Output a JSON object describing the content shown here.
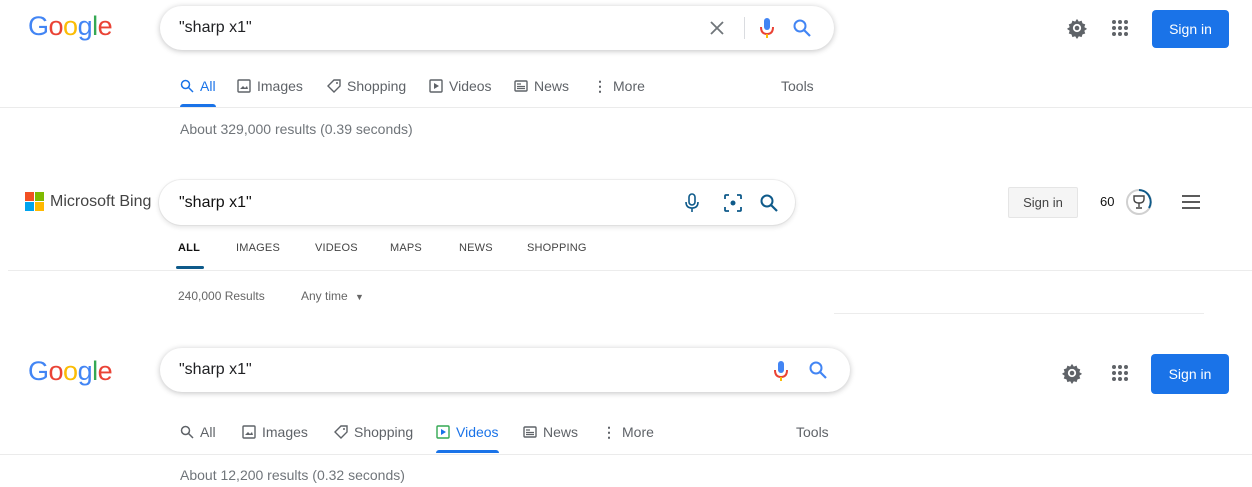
{
  "panel1": {
    "logo": "Google",
    "query": "\"sharp x1\"",
    "tabs": [
      {
        "label": "All",
        "icon": "search-icon",
        "active": true
      },
      {
        "label": "Images",
        "icon": "image-icon"
      },
      {
        "label": "Shopping",
        "icon": "tag-icon"
      },
      {
        "label": "Videos",
        "icon": "play-icon"
      },
      {
        "label": "News",
        "icon": "news-icon"
      },
      {
        "label": "More",
        "icon": "more-vert-icon"
      }
    ],
    "tools": "Tools",
    "stats": "About 329,000 results (0.39 seconds)",
    "signin": "Sign in"
  },
  "panel2": {
    "logo": "Microsoft Bing",
    "query": "\"sharp x1\"",
    "tabs": [
      "ALL",
      "IMAGES",
      "VIDEOS",
      "MAPS",
      "NEWS",
      "SHOPPING"
    ],
    "signin": "Sign in",
    "points": "60",
    "results": "240,000 Results",
    "time_filter": "Any time"
  },
  "panel3": {
    "logo": "Google",
    "query": "\"sharp x1\"",
    "tabs": [
      {
        "label": "All",
        "icon": "search-icon"
      },
      {
        "label": "Images",
        "icon": "image-icon"
      },
      {
        "label": "Shopping",
        "icon": "tag-icon"
      },
      {
        "label": "Videos",
        "icon": "play-icon",
        "active": true
      },
      {
        "label": "News",
        "icon": "news-icon"
      },
      {
        "label": "More",
        "icon": "more-vert-icon"
      }
    ],
    "tools": "Tools",
    "stats": "About 12,200 results (0.32 seconds)",
    "signin": "Sign in"
  },
  "colors": {
    "google_blue": "#4285f4",
    "google_red": "#ea4335",
    "google_yellow": "#fbbc05",
    "google_green": "#34a853",
    "bing_teal": "#0e5a8a"
  }
}
